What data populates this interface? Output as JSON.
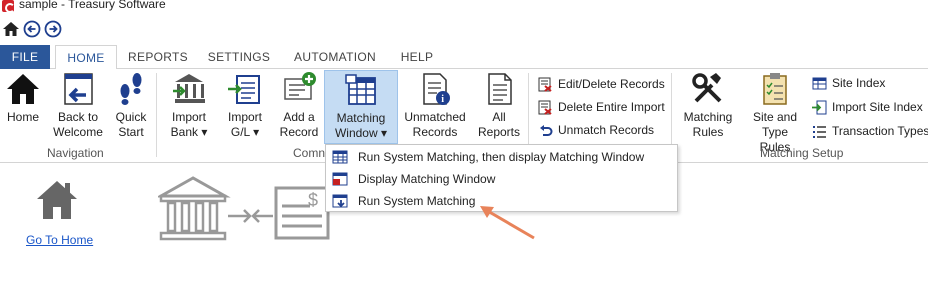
{
  "window": {
    "title": "sample - Treasury Software"
  },
  "tabs": [
    "FILE",
    "HOME",
    "REPORTS",
    "SETTINGS",
    "AUTOMATION",
    "HELP"
  ],
  "ribbon": {
    "navigation": {
      "label": "Navigation",
      "home": "Home",
      "back1": "Back to",
      "back2": "Welcome",
      "quick1": "Quick",
      "quick2": "Start"
    },
    "common": {
      "label": "Comn",
      "importbank1": "Import",
      "importbank2": "Bank ▾",
      "importgl1": "Import",
      "importgl2": "G/L ▾",
      "addrecord1": "Add a",
      "addrecord2": "Record",
      "matching1": "Matching",
      "matching2": "Window ▾",
      "unmatched1": "Unmatched",
      "unmatched2": "Records",
      "all1": "All",
      "all2": "Reports",
      "edit_delete": "Edit/Delete Records",
      "delete_import": "Delete Entire Import",
      "unmatch": "Unmatch Records"
    },
    "setup": {
      "label": "Matching Setup",
      "rules1": "Matching",
      "rules2": "Rules",
      "site1": "Site and",
      "site2": "Type Rules",
      "site_index": "Site Index",
      "import_site": "Import Site Index",
      "transaction_types": "Transaction Types"
    }
  },
  "dropdown": {
    "item1": "Run System Matching, then display Matching Window",
    "item2": "Display Matching Window",
    "item3": "Run System Matching"
  },
  "content": {
    "go_home": "Go To Home"
  },
  "colors": {
    "file_tab": "#2b579a",
    "selected": "#c5dcf3",
    "annotation_arrow": "#e8835a",
    "link": "#1a56c8"
  }
}
